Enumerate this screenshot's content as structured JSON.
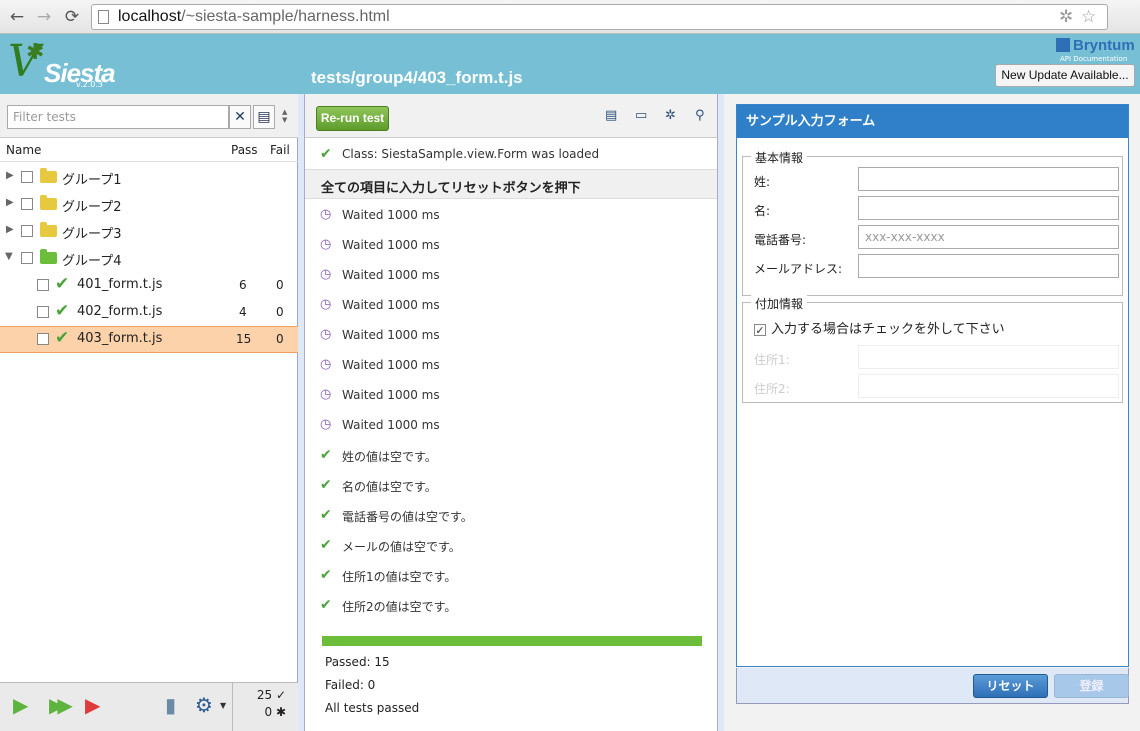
{
  "browser": {
    "url_host": "localhost",
    "url_path": "/~siesta-sample/harness.html",
    "back_glyph": "←",
    "forward_glyph": "→",
    "reload_glyph": "⟳"
  },
  "header": {
    "logo_text": "Siesta",
    "logo_version": "v.2.0.3",
    "test_path": "tests/group4/403_form.t.js",
    "brand": "Bryntum",
    "api_doc_label": "API Documentation",
    "update_button": "New Update Available..."
  },
  "left": {
    "filter_placeholder": "Filter tests",
    "columns": {
      "name": "Name",
      "pass": "Pass",
      "fail": "Fail"
    },
    "groups": [
      {
        "label": "グループ1"
      },
      {
        "label": "グループ2"
      },
      {
        "label": "グループ3"
      },
      {
        "label": "グループ4"
      }
    ],
    "tests": [
      {
        "label": "401_form.t.js",
        "pass": "6",
        "fail": "0"
      },
      {
        "label": "402_form.t.js",
        "pass": "4",
        "fail": "0"
      },
      {
        "label": "403_form.t.js",
        "pass": "15",
        "fail": "0"
      }
    ],
    "stats": {
      "passed": "25",
      "failed": "0"
    }
  },
  "center": {
    "rerun_button": "Re-run test",
    "class_loaded": "Class: SiestaSample.view.Form was loaded",
    "section_title": "全ての項目に入力してリセットボタンを押下",
    "waits": [
      "Waited 1000 ms",
      "Waited 1000 ms",
      "Waited 1000 ms",
      "Waited 1000 ms",
      "Waited 1000 ms",
      "Waited 1000 ms",
      "Waited 1000 ms",
      "Waited 1000 ms"
    ],
    "assertions": [
      "姓の値は空です。",
      "名の値は空です。",
      "電話番号の値は空です。",
      "メールの値は空です。",
      "住所1の値は空です。",
      "住所2の値は空です。"
    ],
    "progress_fraction": 1.0,
    "summary": {
      "passed": "Passed: 15",
      "failed": "Failed: 0",
      "status": "All tests passed"
    }
  },
  "form": {
    "title": "サンプル入力フォーム",
    "basic_legend": "基本情報",
    "fields": [
      {
        "label": "姓:",
        "value": "",
        "placeholder": ""
      },
      {
        "label": "名:",
        "value": "",
        "placeholder": ""
      },
      {
        "label": "電話番号:",
        "value": "",
        "placeholder": "xxx-xxx-xxxx"
      },
      {
        "label": "メールアドレス:",
        "value": "",
        "placeholder": ""
      }
    ],
    "extra_legend": "付加情報",
    "checkbox_label": "入力する場合はチェックを外して下さい",
    "checkbox_checked": true,
    "address_fields": [
      {
        "label": "住所1:"
      },
      {
        "label": "住所2:"
      }
    ],
    "reset_button": "リセット",
    "submit_button": "登録"
  },
  "colors": {
    "header_bg": "#77bfd4",
    "pass_green": "#4aa33a",
    "selected_row": "#fbd2aa",
    "form_title_bg": "#2f80c8"
  }
}
